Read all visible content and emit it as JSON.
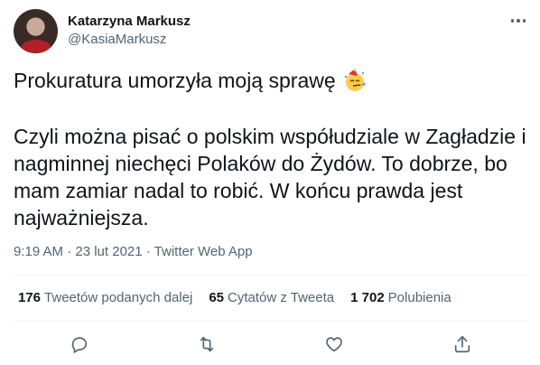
{
  "author": {
    "display_name": "Katarzyna Markusz",
    "handle": "@KasiaMarkusz"
  },
  "tweet": {
    "line1": "Prokuratura umorzyła moją sprawę",
    "emoji": "party-face-emoji",
    "paragraph2": "Czyli można pisać o polskim współudziale w Zagładzie i nagminnej niechęci Polaków do Żydów. To dobrze, bo mam zamiar nadal to robić. W końcu prawda jest najważniejsza.",
    "meta": "9:19 AM · 23 lut 2021 · Twitter Web App"
  },
  "stats": [
    {
      "count": "176",
      "label": "Tweetów podanych dalej"
    },
    {
      "count": "65",
      "label": "Cytatów z Tweeta"
    },
    {
      "count": "1 702",
      "label": "Polubienia"
    }
  ],
  "icons": {
    "more": "more-icon",
    "reply": "reply-icon",
    "retweet": "retweet-icon",
    "like": "like-icon",
    "share": "share-icon"
  },
  "colors": {
    "text": "#0f1419",
    "secondary": "#536471",
    "divider": "#eff3f4"
  }
}
